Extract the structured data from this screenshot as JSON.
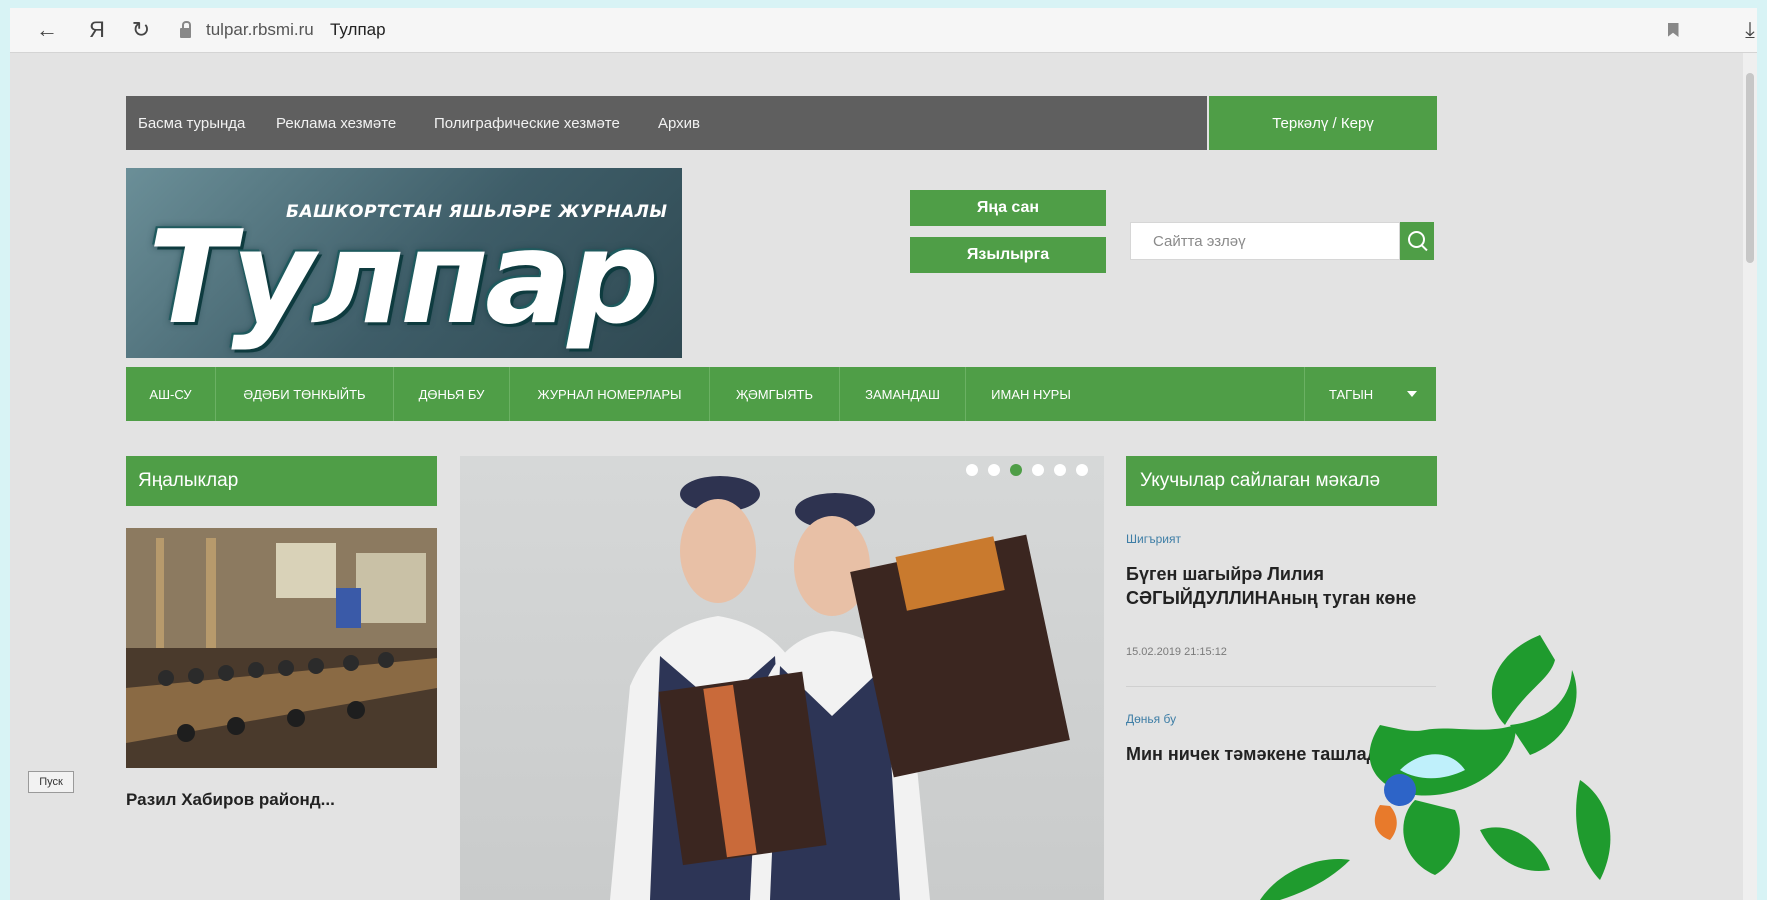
{
  "browser": {
    "back_icon": "arrow-left-icon",
    "yandex_label": "Я",
    "reload_icon": "reload-icon",
    "url": "tulpar.rbsmi.ru",
    "tab_title": "Тулпар",
    "bookmark_icon": "bookmark-icon",
    "download_icon": "download-icon"
  },
  "top_nav": {
    "items": [
      "Басма турында",
      "Реклама хезмәте",
      "Полиграфические хезмәте",
      "Архив"
    ],
    "login": "Теркәлү / Керү"
  },
  "header": {
    "logo_subtitle": "БАШКОРТСТАН ЯШЬЛӘРЕ ЖУРНАЛЫ",
    "logo_word": "Тулпар",
    "new_issue": "Яңа сан",
    "subscribe": "Язылырга",
    "search_placeholder": "Сайтта эзләү"
  },
  "categories": {
    "items": [
      "АШ-СУ",
      "ӘДӘБИ ТӨНКЫЙТЬ",
      "ДӨНЬЯ БУ",
      "ЖУРНАЛ НОМЕРЛАРЫ",
      "ҖӘМГЫЯТЬ",
      "ЗАМАНДАШ",
      "ИМАН НУРЫ"
    ],
    "more": "ТАГЫН"
  },
  "news": {
    "heading": "Яңалыклар",
    "first_title": "Разил Хабиров районд..."
  },
  "slider": {
    "dot_count": 6,
    "active_dot": 3
  },
  "popular": {
    "heading": "Укучылар сайлаган мәкалә",
    "articles": [
      {
        "category": "Шигърият",
        "title": "Бүген шагыйрә Лилия СӘГЫЙДУЛЛИНАның туган көне",
        "date": "15.02.2019 21:15:12"
      },
      {
        "category": "Дөнья бу",
        "title": "Мин ничек тәмәкене ташладым?"
      }
    ]
  },
  "taskbar": {
    "start": "Пуск"
  },
  "colors": {
    "accent": "#4f9e47",
    "nav_dark": "#5f5f5f",
    "frame": "#d8f3f5"
  }
}
